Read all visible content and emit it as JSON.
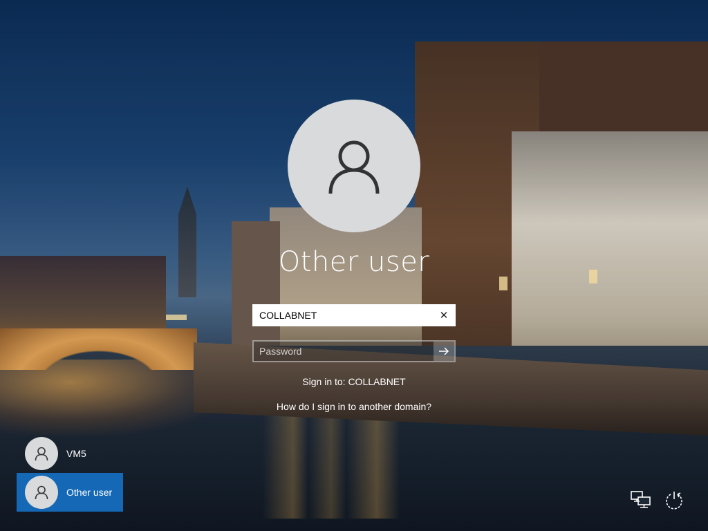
{
  "login": {
    "username_title": "Other user",
    "username_value": "COLLABNET",
    "password_placeholder": "Password",
    "sign_in_to": "Sign in to: COLLABNET",
    "help_link": "How do I sign in to another domain?"
  },
  "users": [
    {
      "name": "VM5",
      "selected": false
    },
    {
      "name": "Other user",
      "selected": true
    }
  ],
  "icons": {
    "avatar": "person-icon",
    "clear": "close-icon",
    "submit": "arrow-right-icon",
    "network": "network-icon",
    "power": "power-icon"
  },
  "colors": {
    "selected_user_bg": "#1468b5",
    "avatar_bg": "#d9dadb"
  }
}
